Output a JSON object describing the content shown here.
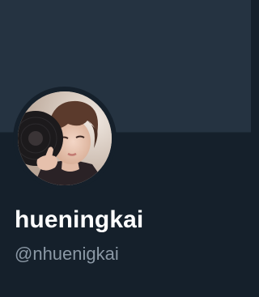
{
  "profile": {
    "display_name": "hueningkai",
    "handle": "@nhuenigkai",
    "avatar_icon": "profile-photo",
    "banner_color": "#253341"
  },
  "theme": {
    "background": "#15202b",
    "name_color": "#ffffff",
    "handle_color": "#8b98a5"
  }
}
